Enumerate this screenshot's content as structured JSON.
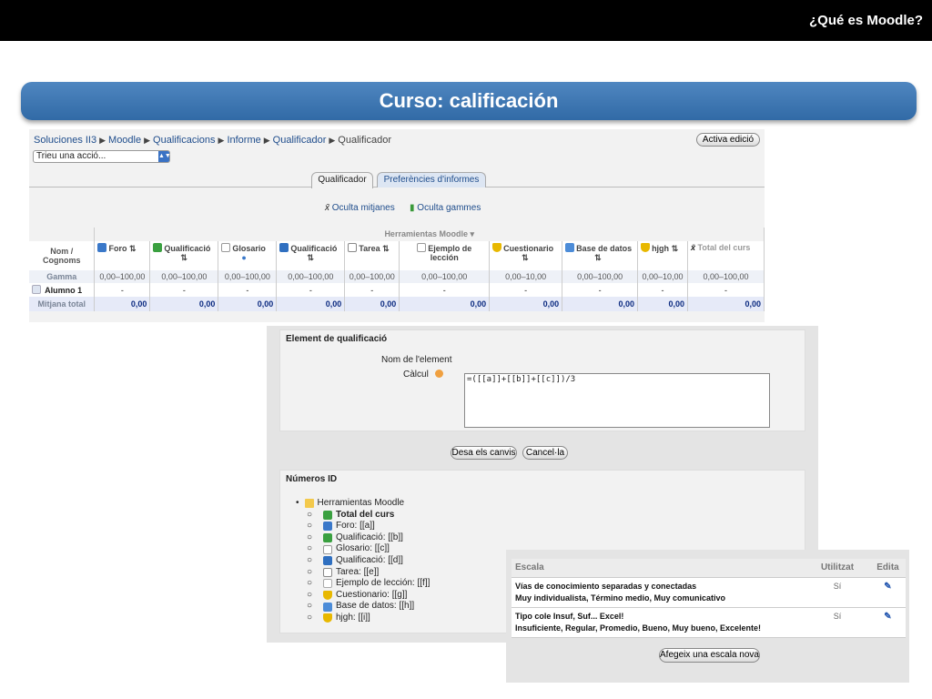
{
  "slide": {
    "header_title": "¿Qué es Moodle?",
    "banner_title": "Curso: calificación"
  },
  "grader": {
    "breadcrumb": [
      "Soluciones II3",
      "Moodle",
      "Qualificacions",
      "Informe",
      "Qualificador",
      "Qualificador"
    ],
    "edit_button": "Activa edició",
    "action_select": "Trieu una acció...",
    "tabs": [
      "Qualificador",
      "Preferències d'informes"
    ],
    "options": [
      "Oculta mitjanes",
      "Oculta gammes"
    ],
    "category": "Herramientas Moodle",
    "name_col": "Nom / Cognoms",
    "columns": [
      {
        "label": "Foro",
        "icon": "forum-icon",
        "color": "#3a78c9"
      },
      {
        "label": "Qualificació",
        "icon": "flask-icon",
        "color": "#3aa040"
      },
      {
        "label": "Glosario",
        "icon": "glossary-icon",
        "color": "#999999"
      },
      {
        "label": "Qualificació",
        "icon": "book-icon",
        "color": "#2f6fc0"
      },
      {
        "label": "Tarea",
        "icon": "assignment-icon",
        "color": "#888888"
      },
      {
        "label": "Ejemplo de lección",
        "icon": "lesson-icon",
        "color": "#aaaaaa"
      },
      {
        "label": "Cuestionario",
        "icon": "quiz-shield-icon",
        "color": "#e8b800"
      },
      {
        "label": "Base de datos",
        "icon": "database-icon",
        "color": "#4c8cd8"
      },
      {
        "label": "hjgh",
        "icon": "quiz-shield-icon",
        "color": "#e8b800"
      },
      {
        "label": "Total del curs",
        "icon": "total-icon",
        "color": "#555555"
      }
    ],
    "gamma_label": "Gamma",
    "gamma_values": [
      "0,00–100,00",
      "0,00–100,00",
      "0,00–100,00",
      "0,00–100,00",
      "0,00–100,00",
      "0,00–100,00",
      "0,00–10,00",
      "0,00–100,00",
      "0,00–10,00",
      "0,00–100,00"
    ],
    "student": "Alumno 1",
    "student_values": [
      "-",
      "-",
      "-",
      "-",
      "-",
      "-",
      "-",
      "-",
      "-",
      "-"
    ],
    "total_label": "Mitjana total",
    "total_values": [
      "0,00",
      "0,00",
      "0,00",
      "0,00",
      "0,00",
      "0,00",
      "0,00",
      "0,00",
      "0,00",
      "0,00"
    ]
  },
  "calc_form": {
    "legend": "Element de qualificació",
    "name_label": "Nom de l'element",
    "calc_label": "Càlcul",
    "calc_value": "=([[a]]+[[b]]+[[c]])/3",
    "save_button": "Desa els canvis",
    "cancel_button": "Cancel·la",
    "ids_legend": "Números ID",
    "tree_root": "Herramientas Moodle",
    "tree_items": [
      {
        "label": "Total del curs",
        "bold": true,
        "icon": "calculator-icon",
        "color": "#3aa040"
      },
      {
        "label": "Foro: [[a]]",
        "icon": "forum-icon",
        "color": "#3a78c9"
      },
      {
        "label": "Qualificació: [[b]]",
        "icon": "flask-icon",
        "color": "#3aa040"
      },
      {
        "label": "Glosario: [[c]]",
        "icon": "glossary-icon",
        "color": "#999999"
      },
      {
        "label": "Qualificació: [[d]]",
        "icon": "book-icon",
        "color": "#2f6fc0"
      },
      {
        "label": "Tarea: [[e]]",
        "icon": "assignment-icon",
        "color": "#888888"
      },
      {
        "label": "Ejemplo de lección: [[f]]",
        "icon": "lesson-icon",
        "color": "#aaaaaa"
      },
      {
        "label": "Cuestionario: [[g]]",
        "icon": "quiz-shield-icon",
        "color": "#e8b800"
      },
      {
        "label": "Base de datos: [[h]]",
        "icon": "database-icon",
        "color": "#4c8cd8"
      },
      {
        "label": "hjgh: [[i]]",
        "icon": "quiz-shield-icon",
        "color": "#e8b800"
      }
    ]
  },
  "scales": {
    "headers": [
      "Escala",
      "Utilitzat",
      "Edita"
    ],
    "rows": [
      {
        "name": "Vías de conocimiento separadas y conectadas",
        "values": "Muy individualista, Término medio, Muy comunicativo",
        "used": "Sí"
      },
      {
        "name": "Tipo cole Insuf, Suf... Excel!",
        "values": "Insuficiente, Regular, Promedio, Bueno, Muy bueno, Excelente!",
        "used": "Sí"
      }
    ],
    "add_button": "Afegeix una escala nova"
  }
}
